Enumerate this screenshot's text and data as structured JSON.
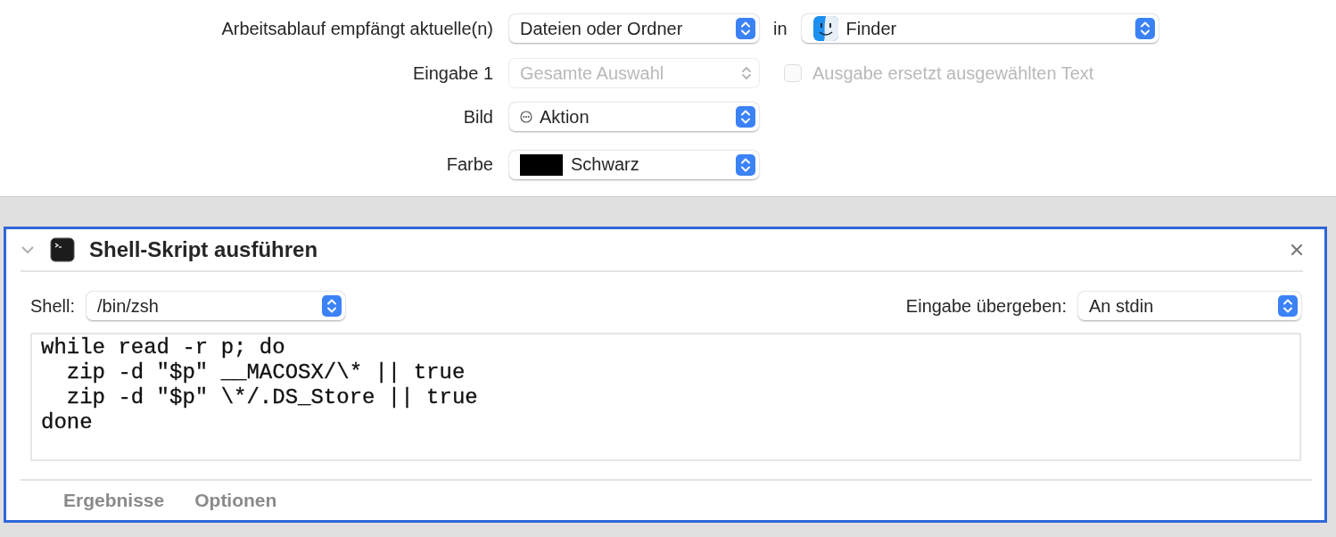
{
  "workflow": {
    "rows": [
      {
        "kind": "source",
        "label": "Arbeitsablauf empfängt aktuelle(n)",
        "popup": {
          "value": "Dateien oder Ordner",
          "disabled": false
        },
        "in_label": "in",
        "app_popup": {
          "value": "Finder",
          "disabled": false
        }
      },
      {
        "kind": "input",
        "label": "Eingabe 1",
        "popup": {
          "value": "Gesamte Auswahl",
          "disabled": true
        },
        "checkbox": {
          "label": "Ausgabe ersetzt ausgewählten Text",
          "checked": false,
          "disabled": true
        }
      },
      {
        "kind": "image",
        "label": "Bild",
        "popup": {
          "value": "Aktion",
          "disabled": false
        }
      },
      {
        "kind": "color",
        "label": "Farbe",
        "popup": {
          "value": "Schwarz",
          "disabled": false,
          "color": "#000000"
        }
      }
    ]
  },
  "action": {
    "title": "Shell-Skript ausführen",
    "expanded": true,
    "selected": true,
    "shell_label": "Shell:",
    "shell_popup": {
      "value": "/bin/zsh",
      "disabled": false
    },
    "pass_label": "Eingabe übergeben:",
    "pass_popup": {
      "value": "An stdin",
      "disabled": false
    },
    "code": [
      "while read -r p; do",
      "  zip -d \"$p\" __MACOSX/\\* || true",
      "  zip -d \"$p\" \\*/.DS_Store || true",
      "done"
    ],
    "tabs": [
      {
        "label": "Ergebnisse",
        "selected": false
      },
      {
        "label": "Optionen",
        "selected": false
      }
    ]
  }
}
